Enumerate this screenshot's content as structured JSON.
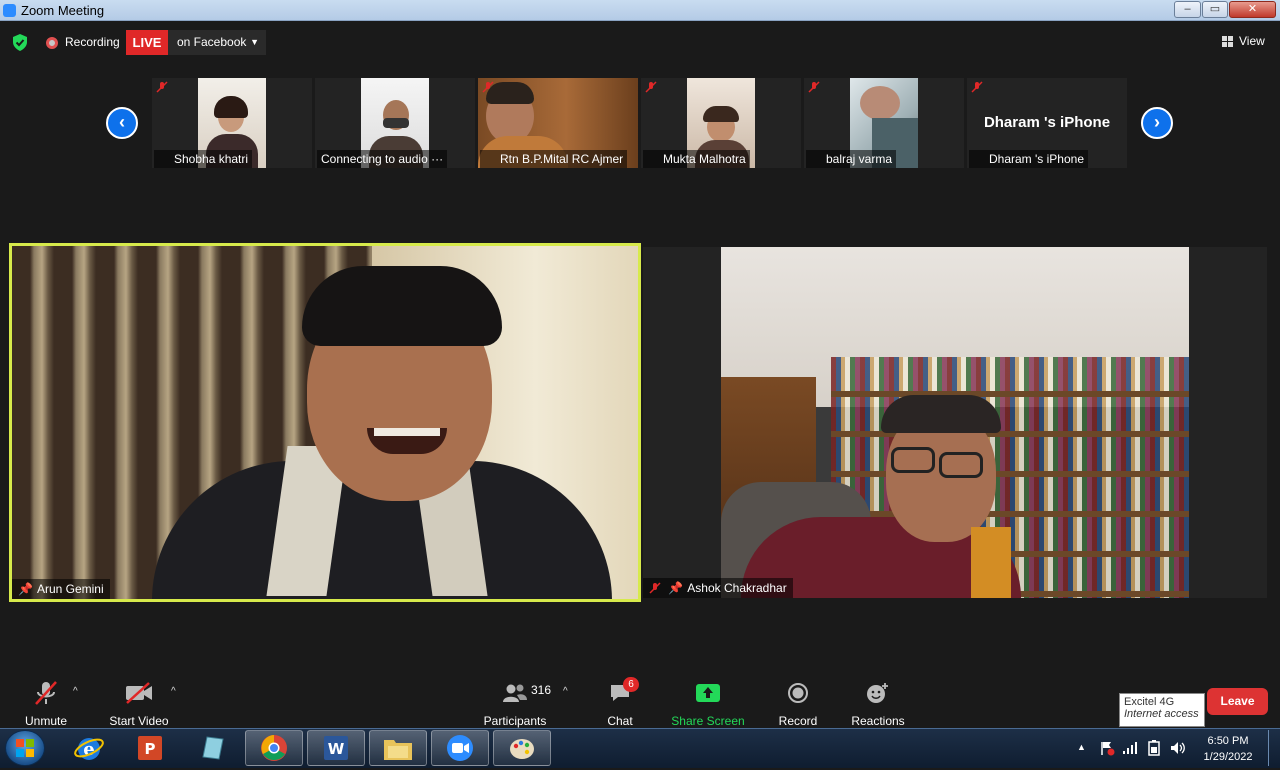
{
  "window": {
    "title": "Zoom Meeting",
    "buttons": [
      "–",
      "▭",
      "✕"
    ]
  },
  "status": {
    "recording_label": "Recording",
    "live_badge": "LIVE",
    "live_target": "on Facebook",
    "view_label": "View"
  },
  "gallery": {
    "tiles": [
      {
        "name": "Shobha khatri",
        "muted": true
      },
      {
        "name": "Connecting to audio ···",
        "muted": false
      },
      {
        "name": "Rtn B.P.Mital RC Ajmer",
        "muted": true
      },
      {
        "name": "Mukta Malhotra",
        "muted": true
      },
      {
        "name": "balraj varma",
        "muted": true
      },
      {
        "name": "Dharam 's iPhone",
        "muted": true,
        "display_text": "Dharam 's iPhone"
      }
    ]
  },
  "main": {
    "left_name": "Arun Gemini",
    "right_name": "Ashok Chakradhar"
  },
  "toolbar": {
    "unmute": "Unmute",
    "start_video": "Start Video",
    "participants_count": "316",
    "participants": "Participants",
    "chat": "Chat",
    "chat_badge": "6",
    "share_screen": "Share Screen",
    "record": "Record",
    "reactions": "Reactions",
    "leave": "Leave"
  },
  "network_tooltip": {
    "name": "Excitel 4G",
    "status": "Internet access"
  },
  "taskbar": {
    "time": "6:50 PM",
    "date": "1/29/2022",
    "apps": [
      "internet-explorer",
      "powerpoint",
      "notebook",
      "chrome",
      "word",
      "file-explorer",
      "zoom",
      "paint"
    ]
  },
  "colors": {
    "live": "#e02828",
    "active_speaker_border": "#d7ea4b",
    "share_green": "#23d959",
    "nav_blue": "#0e71eb",
    "leave": "#dd3333"
  }
}
